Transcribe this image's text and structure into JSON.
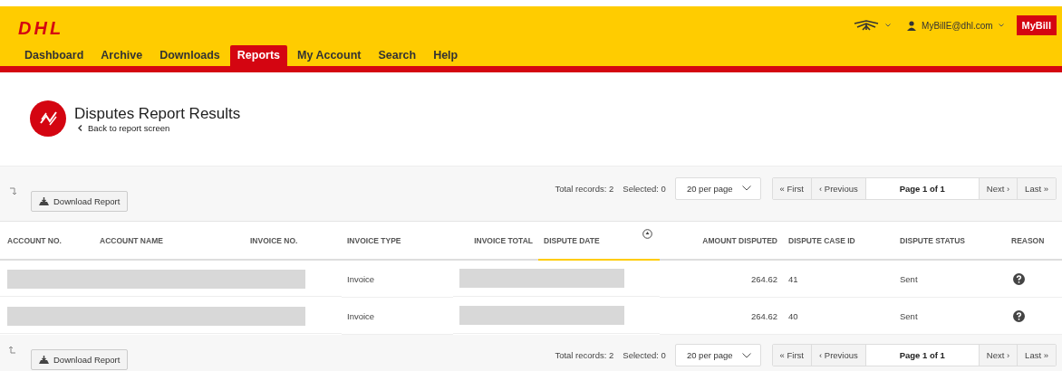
{
  "logo": "DHL",
  "header": {
    "user_email": "MyBillE@dhl.com",
    "app_button": "MyBill"
  },
  "nav": [
    {
      "label": "Dashboard",
      "selected": false
    },
    {
      "label": "Archive",
      "selected": false
    },
    {
      "label": "Downloads",
      "selected": false
    },
    {
      "label": "Reports",
      "selected": true
    },
    {
      "label": "My Account",
      "selected": false
    },
    {
      "label": "Search",
      "selected": false
    },
    {
      "label": "Help",
      "selected": false
    }
  ],
  "page": {
    "title": "Disputes Report Results",
    "back_link": "Back to report screen"
  },
  "toolbars": [
    {
      "kind": "top",
      "download_button": "Download Report",
      "total_records": "Total records: 2",
      "selected_count": "Selected: 0",
      "per_page": "20 per page",
      "pager": {
        "first": "« First",
        "previous": "‹ Previous",
        "page": "Page 1 of 1",
        "next": "Next ›",
        "last": "Last »"
      }
    },
    {
      "kind": "bottom",
      "download_button": "Download Report",
      "total_records": "Total records: 2",
      "selected_count": "Selected: 0",
      "per_page": "20 per page",
      "pager": {
        "first": "« First",
        "previous": "‹ Previous",
        "page": "Page 1 of 1",
        "next": "Next ›",
        "last": "Last »"
      }
    }
  ],
  "table": {
    "columns": [
      {
        "label": "ACCOUNT NO.",
        "sorted": false
      },
      {
        "label": "ACCOUNT NAME",
        "sorted": false
      },
      {
        "label": "INVOICE NO.",
        "sorted": false
      },
      {
        "label": "INVOICE TYPE",
        "sorted": false
      },
      {
        "label": "INVOICE TOTAL",
        "sorted": false
      },
      {
        "label": "DISPUTE DATE",
        "sorted": true
      },
      {
        "label": "AMOUNT DISPUTED",
        "sorted": false
      },
      {
        "label": "DISPUTE CASE ID",
        "sorted": false
      },
      {
        "label": "DISPUTE STATUS",
        "sorted": false
      },
      {
        "label": "REASON",
        "sorted": false
      }
    ],
    "rows": [
      {
        "invoice_type": "Invoice",
        "amount_disputed": "264.62",
        "dispute_case_id": "41",
        "dispute_status": "Sent"
      },
      {
        "invoice_type": "Invoice",
        "amount_disputed": "264.62",
        "dispute_case_id": "40",
        "dispute_status": "Sent"
      }
    ]
  }
}
